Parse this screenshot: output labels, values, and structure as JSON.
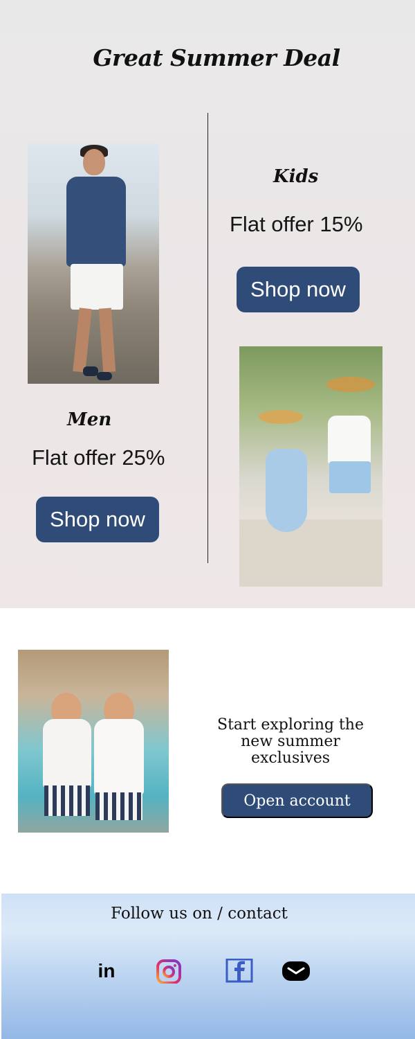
{
  "hero": {
    "title": "Great Summer Deal"
  },
  "men": {
    "title": "Men",
    "offer": "Flat offer 25%",
    "button": "Shop now"
  },
  "kids": {
    "title": "Kids",
    "offer": "Flat offer 15%",
    "button": "Shop now"
  },
  "promo": {
    "text_line1": "Start exploring the",
    "text_line2": "new summer",
    "text_line3": "exclusives",
    "button": "Open account"
  },
  "footer": {
    "title": "Follow us on / contact",
    "icons": [
      "linkedin-icon",
      "instagram-icon",
      "facebook-icon",
      "mail-icon"
    ],
    "linkedin_text": "in"
  },
  "colors": {
    "accent": "#2f4c78",
    "hero_bg": "#ebe7e7",
    "footer_bg": "#b9d2f0"
  }
}
